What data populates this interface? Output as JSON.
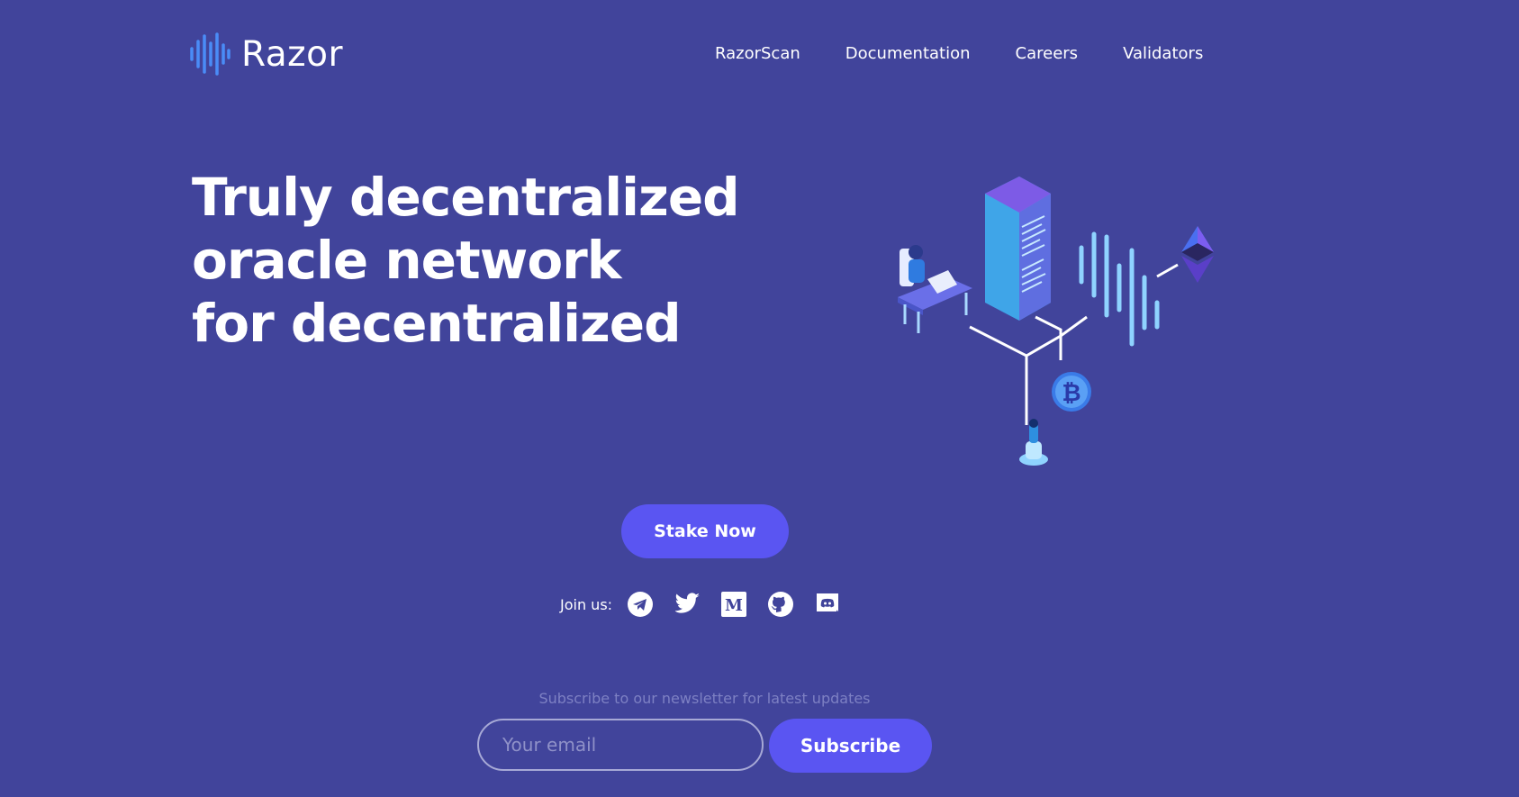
{
  "brand": {
    "name": "Razor",
    "icon": "sound-wave-logo-icon",
    "accent": "#4a8cf7"
  },
  "nav": {
    "items": [
      {
        "label": "RazorScan"
      },
      {
        "label": "Documentation"
      },
      {
        "label": "Careers"
      },
      {
        "label": "Validators"
      }
    ]
  },
  "hero": {
    "lines": [
      "Truly decentralized",
      "oracle network",
      "for decentralized"
    ],
    "cta_label": "Stake Now"
  },
  "social": {
    "label": "Join us:",
    "icons": [
      "telegram-icon",
      "twitter-icon",
      "medium-icon",
      "github-icon",
      "discord-icon"
    ]
  },
  "newsletter": {
    "text": "Subscribe to our newsletter for latest updates",
    "email_placeholder": "Your email",
    "button_label": "Subscribe"
  },
  "colors": {
    "background": "#41449b",
    "button": "#5a55f2",
    "text": "#ffffff"
  }
}
